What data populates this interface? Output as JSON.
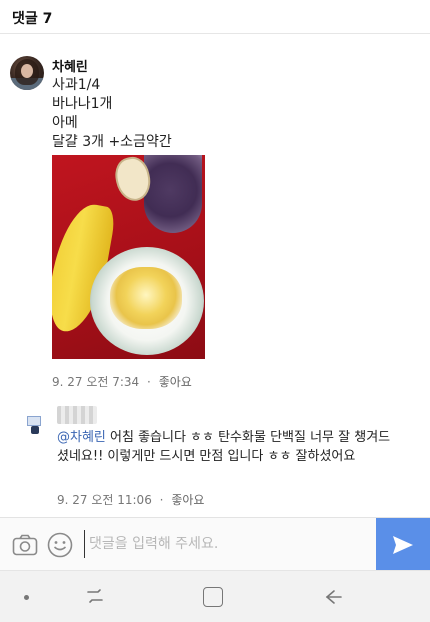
{
  "header": {
    "title": "댓글 7"
  },
  "comment1": {
    "author": "차혜린",
    "lines": [
      "사과1/4",
      "바나나1개",
      "아메",
      "달걀 3개 +소금약간"
    ],
    "date": "9. 27 오전 7:34",
    "separator": "·",
    "like": "좋아요"
  },
  "comment2": {
    "mention": "@차혜린",
    "body": " 어침 좋습니다 ㅎㅎ 탄수화물 단백질 너무 잘 챙겨드셨네요!! 이렇게만 드시면 만점 입니다 ㅎㅎ 잘하셨어요",
    "date": "9. 27 오전 11:06",
    "separator": "·",
    "like": "좋아요"
  },
  "composer": {
    "placeholder": "댓글을 입력해 주세요."
  },
  "icons": {
    "camera": "camera-icon",
    "emoji": "smile-icon",
    "send": "send-icon",
    "nav_recent": "recent-apps-icon",
    "nav_home": "home-icon",
    "nav_back": "back-icon"
  },
  "colors": {
    "accent": "#5a8fe8",
    "mention": "#3b66b3"
  }
}
